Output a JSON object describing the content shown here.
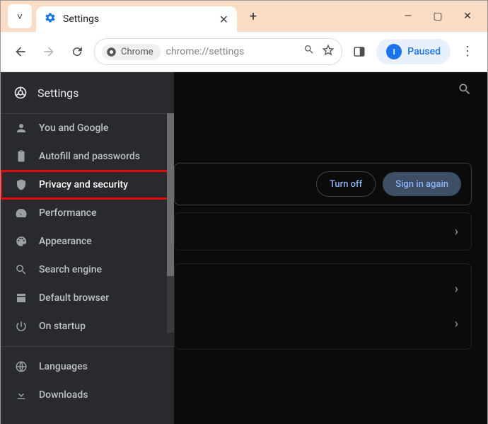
{
  "titlebar": {
    "tab_title": "Settings"
  },
  "toolbar": {
    "chip_label": "Chrome",
    "url": "chrome://settings",
    "paused_avatar_letter": "I",
    "paused_label": "Paused"
  },
  "sidebar": {
    "heading": "Settings",
    "items": [
      {
        "id": "you-and-google",
        "label": "You and Google"
      },
      {
        "id": "autofill",
        "label": "Autofill and passwords"
      },
      {
        "id": "privacy",
        "label": "Privacy and security",
        "highlighted": true
      },
      {
        "id": "performance",
        "label": "Performance"
      },
      {
        "id": "appearance",
        "label": "Appearance"
      },
      {
        "id": "search-engine",
        "label": "Search engine"
      },
      {
        "id": "default-browser",
        "label": "Default browser"
      },
      {
        "id": "on-startup",
        "label": "On startup"
      },
      {
        "id": "languages",
        "label": "Languages"
      },
      {
        "id": "downloads",
        "label": "Downloads"
      }
    ]
  },
  "content": {
    "turn_off_label": "Turn off",
    "sign_in_again_label": "Sign in again"
  }
}
